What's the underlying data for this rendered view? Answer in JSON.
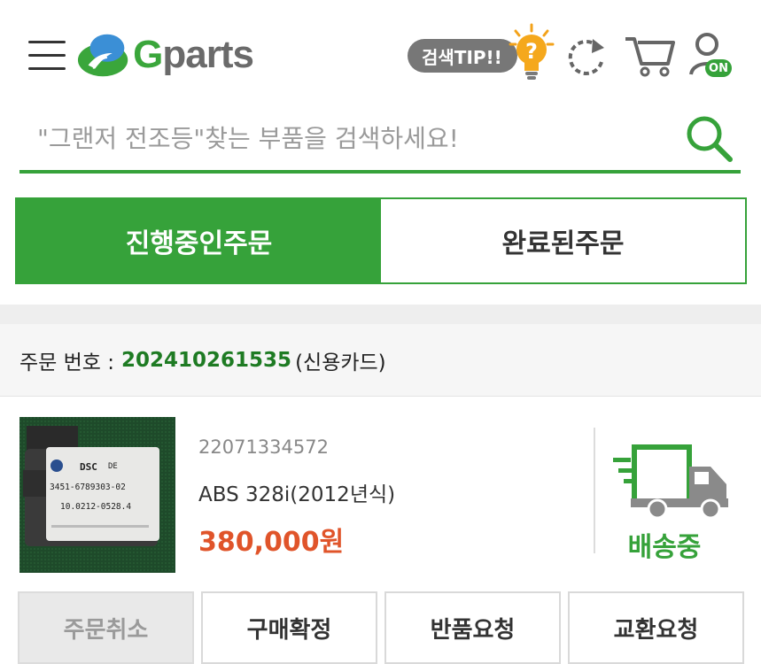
{
  "colors": {
    "brand_green": "#36a23a",
    "order_number": "#1e7b23",
    "price": "#e0542a",
    "tip_pill": "#777777"
  },
  "header": {
    "logo_g": "G",
    "logo_rest": "parts",
    "tip_label": "검색TIP!!",
    "user_badge": "ON",
    "icons": [
      "menu-icon",
      "lightbulb-icon",
      "refresh-icon",
      "cart-icon",
      "user-icon"
    ]
  },
  "search": {
    "placeholder": "\"그랜저 전조등\"찾는 부품을 검색하세요!"
  },
  "tabs": [
    {
      "label": "진행중인주문",
      "active": true
    },
    {
      "label": "완료된주문",
      "active": false
    }
  ],
  "order": {
    "prefix": "주문 번호 :",
    "number": "202410261535",
    "payment": "(신용카드)"
  },
  "product": {
    "code": "22071334572",
    "name": "ABS 328i(2012년식)",
    "price": "380,000원",
    "status": "배송중",
    "image_text": {
      "brand": "DSC",
      "origin": "DE",
      "part_no": "3451-6789303-02",
      "serial": "10.0212-0528.4"
    }
  },
  "actions": [
    {
      "label": "주문취소",
      "enabled": false
    },
    {
      "label": "구매확정",
      "enabled": true
    },
    {
      "label": "반품요청",
      "enabled": true
    },
    {
      "label": "교환요청",
      "enabled": true
    }
  ]
}
